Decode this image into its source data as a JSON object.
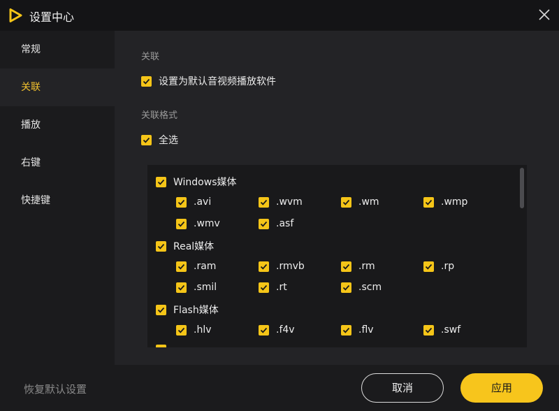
{
  "window": {
    "title": "设置中心",
    "accent": "#f5c518"
  },
  "sidebar": {
    "items": [
      {
        "label": "常规",
        "active": false
      },
      {
        "label": "关联",
        "active": true
      },
      {
        "label": "播放",
        "active": false
      },
      {
        "label": "右键",
        "active": false
      },
      {
        "label": "快捷键",
        "active": false
      }
    ]
  },
  "main": {
    "section1_label": "关联",
    "default_player_label": "设置为默认音视频播放软件",
    "section2_label": "关联格式",
    "select_all_label": "全选",
    "groups": [
      {
        "name": "Windows媒体",
        "formats": [
          ".avi",
          ".wvm",
          ".wm",
          ".wmp",
          ".wmv",
          ".asf"
        ]
      },
      {
        "name": "Real媒体",
        "formats": [
          ".ram",
          ".rmvb",
          ".rm",
          ".rp",
          ".smil",
          ".rt",
          ".scm"
        ]
      },
      {
        "name": "Flash媒体",
        "formats": [
          ".hlv",
          ".f4v",
          ".flv",
          ".swf"
        ]
      }
    ]
  },
  "footer": {
    "restore_label": "恢复默认设置",
    "cancel_label": "取消",
    "apply_label": "应用"
  }
}
